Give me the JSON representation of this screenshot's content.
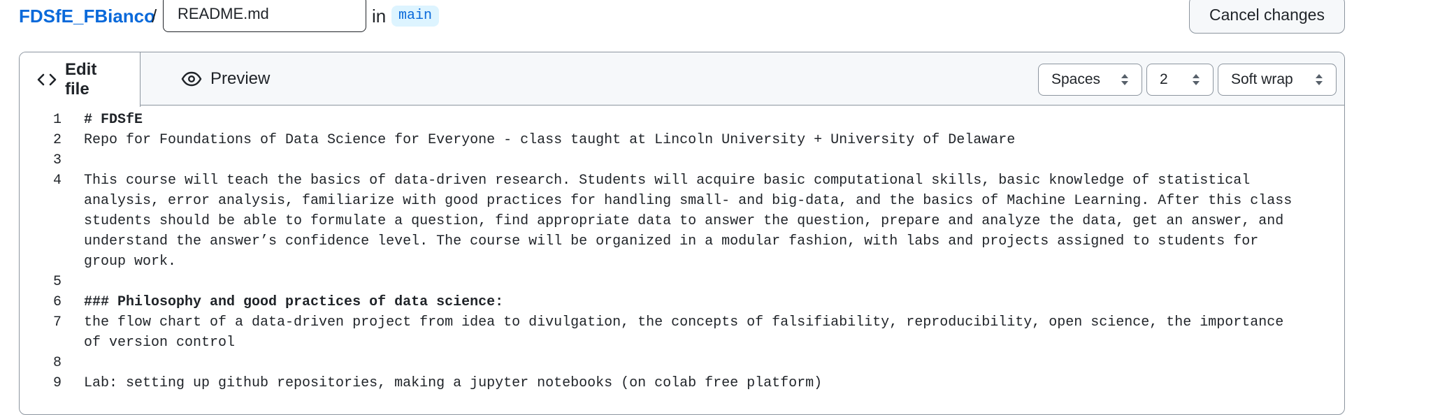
{
  "header": {
    "repo_name": "FDSfE_FBianco",
    "separator": "/",
    "filename_value": "README.md",
    "in_label": "in",
    "branch": "main",
    "cancel_label": "Cancel changes"
  },
  "editor": {
    "tabs": [
      {
        "label": "Edit file",
        "icon": "code-icon",
        "active": true
      },
      {
        "label": "Preview",
        "icon": "eye-icon",
        "active": false
      }
    ],
    "indent_mode": "Spaces",
    "indent_size": "2",
    "wrap_mode": "Soft wrap",
    "lines": [
      {
        "num": "1",
        "text": "# FDSfE",
        "bold": true
      },
      {
        "num": "2",
        "text": "Repo for Foundations of Data Science for Everyone - class taught at Lincoln University + University of Delaware",
        "bold": false
      },
      {
        "num": "3",
        "text": "",
        "bold": false
      },
      {
        "num": "4",
        "text": "This course will teach the basics of data-driven research. Students will acquire basic computational skills, basic knowledge of statistical analysis, error analysis, familiarize with good practices for handling small- and big-data, and the basics of Machine Learning. After this class students should be able to formulate a question, find appropriate data to answer the question, prepare and analyze the data, get an answer, and understand the answer’s confidence level. The course will be organized in a modular fashion, with labs and projects assigned to students for group work.",
        "bold": false
      },
      {
        "num": "5",
        "text": "",
        "bold": false
      },
      {
        "num": "6",
        "text": "### Philosophy and good practices of data science:",
        "bold": true
      },
      {
        "num": "7",
        "text": "the flow chart of a data-driven project from idea to divulgation, the concepts of falsifiability, reproducibility, open science, the importance of version control",
        "bold": false
      },
      {
        "num": "8",
        "text": "",
        "bold": false
      },
      {
        "num": "9",
        "text": "Lab: setting up github repositories, making a jupyter notebooks (on colab free platform)",
        "bold": false
      }
    ]
  },
  "colors": {
    "link": "#0969da",
    "branch_bg": "#ddf4ff",
    "border": "#8c959f",
    "header_bg": "#f6f8fa"
  }
}
